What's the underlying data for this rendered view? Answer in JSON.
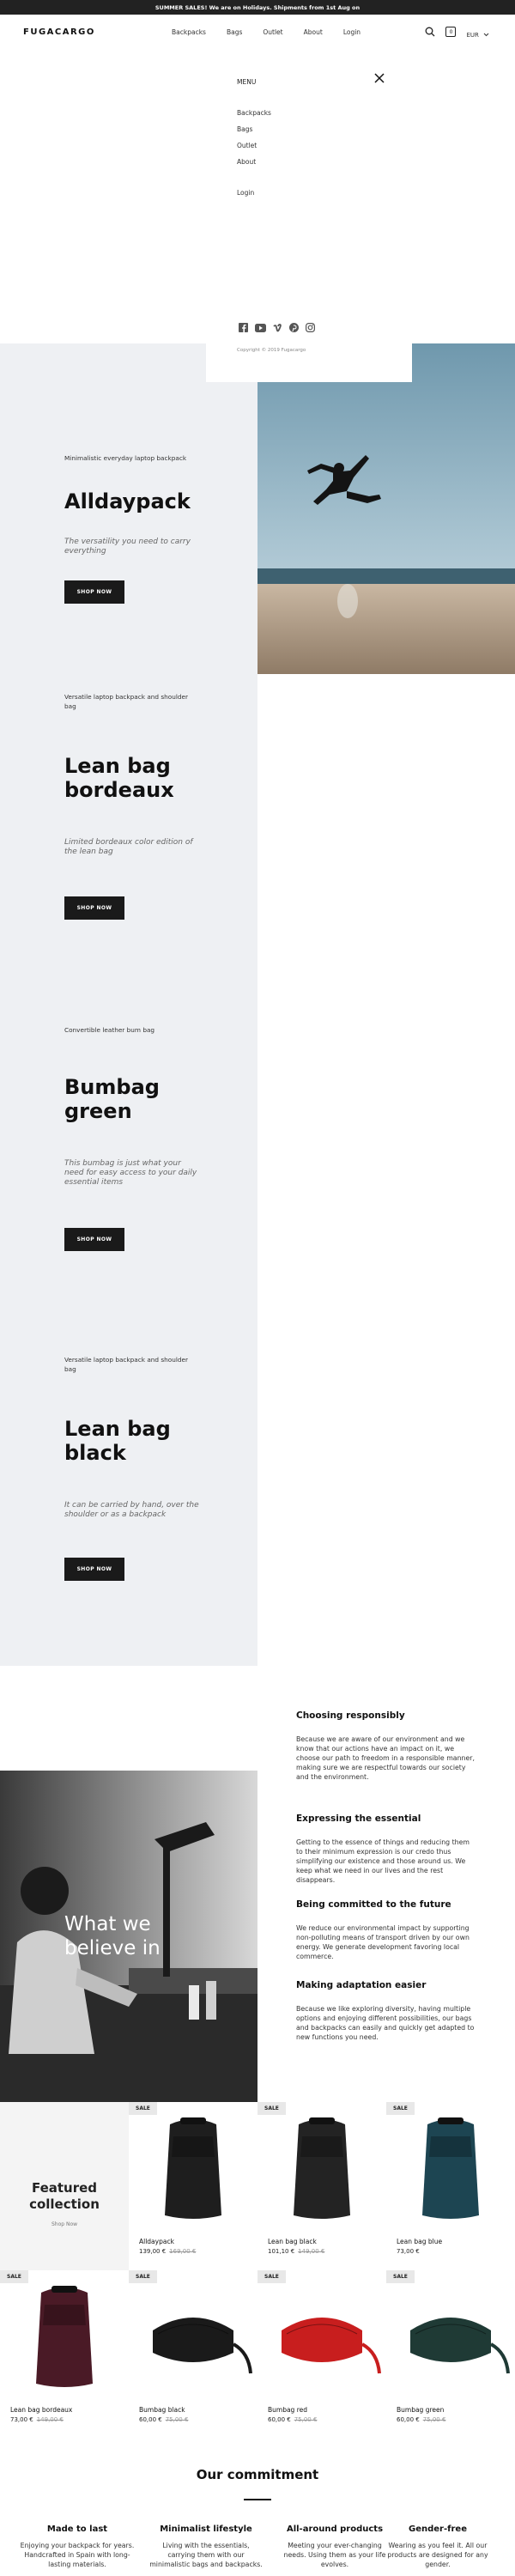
{
  "announcement": "SUMMER SALES! We are on Holidays. Shipments from 1st Aug on",
  "header": {
    "logo": "FUGACARGO",
    "nav": [
      "Backpacks",
      "Bags",
      "Outlet",
      "About",
      "Login"
    ],
    "cart_count": "0",
    "currency": "EUR"
  },
  "menu": {
    "title": "MENU",
    "items": [
      "Backpacks",
      "Bags",
      "Outlet",
      "About"
    ],
    "login": "Login",
    "social_icons": [
      "facebook-icon",
      "youtube-icon",
      "vimeo-icon",
      "pinterest-icon",
      "instagram-icon"
    ],
    "copyright": "Copyright © 2019 Fugacargo"
  },
  "slides": [
    {
      "kicker": "Minimalistic everyday laptop backpack",
      "title": "Alldaypack",
      "desc": "The versatility you need to carry everything",
      "button": "SHOP NOW"
    },
    {
      "kicker": "Versatile laptop backpack and shoulder bag",
      "title": "Lean bag bordeaux",
      "desc": "Limited bordeaux color edition of the lean bag",
      "button": "SHOP NOW"
    },
    {
      "kicker": "Convertible leather bum bag",
      "title": "Bumbag green",
      "desc": "This bumbag is just what your need for easy access to your daily essential items",
      "button": "SHOP NOW"
    },
    {
      "kicker": "Versatile laptop backpack and shoulder bag",
      "title": "Lean bag black",
      "desc": "It can be carried by hand, over the shoulder or as a backpack",
      "button": "SHOP NOW"
    }
  ],
  "values": {
    "title": "What we believe in",
    "blocks": [
      {
        "heading": "Choosing responsibly",
        "text": "Because we are aware of our environment and we know that our actions have an impact on it, we choose our path to freedom in a responsible manner, making sure we are respectful towards our society and the environment."
      },
      {
        "heading": "Expressing the essential",
        "text": "Getting to the essence of things and reducing them to their minimum expression is our credo thus simplifying our existence and those around us. We keep what we need in our lives and the rest disappears."
      },
      {
        "heading": "Being committed to the future",
        "text": "We reduce our environmental impact by supporting non-polluting means of transport driven by our own energy. We generate development favoring local commerce."
      },
      {
        "heading": "Making adaptation easier",
        "text": "Because we like exploring diversity, having multiple options and enjoying different possibilities, our bags and backpacks can easily and quickly get adapted to new functions you need."
      }
    ]
  },
  "featured": {
    "title": "Featured collection",
    "shop_now": "Shop Now",
    "products": [
      {
        "sale": "SALE",
        "name": "Alldaypack",
        "price": "139,00 €",
        "old": "169,00 €",
        "color": "#1e1e1e",
        "shape": "backpack"
      },
      {
        "sale": "SALE",
        "name": "Lean bag black",
        "price": "101,10 €",
        "old": "149,00 €",
        "color": "#232323",
        "shape": "backpack"
      },
      {
        "sale": "SALE",
        "name": "Lean bag blue",
        "price": "73,00 €",
        "old": "",
        "color": "#1d4552",
        "shape": "backpack"
      },
      {
        "sale": "SALE",
        "name": "Lean bag bordeaux",
        "price": "73,00 €",
        "old": "149,00 €",
        "color": "#4a1a26",
        "shape": "backpack"
      },
      {
        "sale": "SALE",
        "name": "Bumbag black",
        "price": "60,00 €",
        "old": "75,00 €",
        "color": "#1a1a1a",
        "shape": "bumbag"
      },
      {
        "sale": "SALE",
        "name": "Bumbag red",
        "price": "60,00 €",
        "old": "75,00 €",
        "color": "#c81e1e",
        "shape": "bumbag"
      },
      {
        "sale": "SALE",
        "name": "Bumbag green",
        "price": "60,00 €",
        "old": "75,00 €",
        "color": "#1f3a35",
        "shape": "bumbag"
      }
    ]
  },
  "commitment": {
    "title": "Our commitment",
    "columns": [
      {
        "heading": "Made to last",
        "text": "Enjoying your backpack for years. Handcrafted in Spain with long-lasting materials."
      },
      {
        "heading": "Minimalist lifestyle",
        "text": "Living with the essentials, carrying them with our minimalistic bags and backpacks."
      },
      {
        "heading": "All-around products",
        "text": "Meeting your ever-changing needs. Using them as your life evolves."
      },
      {
        "heading": "Gender-free",
        "text": "Wearing as you feel it. All our products are designed for any gender."
      }
    ]
  }
}
